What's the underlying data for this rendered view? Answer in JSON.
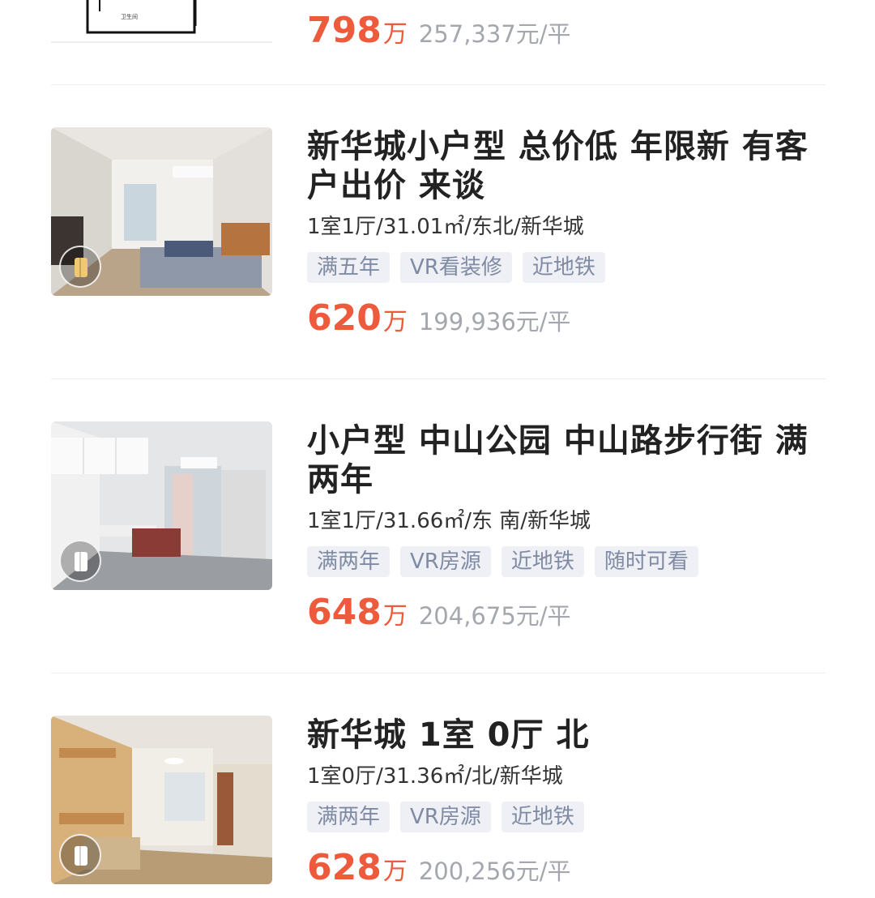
{
  "top_partial": {
    "floorplan_label": "卫生间",
    "price_total": "798",
    "price_unit": "万",
    "price_per": "257,337元/平"
  },
  "listings": [
    {
      "title": "新华城小户型 总价低 年限新 有客户出价 来谈",
      "desc": "1室1厅/31.01㎡/东北/新华城",
      "tags": [
        "满五年",
        "VR看装修",
        "近地铁"
      ],
      "price_total": "620",
      "price_unit": "万",
      "price_per": "199,936元/平",
      "image_icon": "vr-badge-icon"
    },
    {
      "title": "小户型 中山公园 中山路步行街 满两年",
      "desc": "1室1厅/31.66㎡/东 南/新华城",
      "tags": [
        "满两年",
        "VR房源",
        "近地铁",
        "随时可看"
      ],
      "price_total": "648",
      "price_unit": "万",
      "price_per": "204,675元/平",
      "image_icon": "vr-badge-icon"
    },
    {
      "title": "新华城 1室 0厅 北",
      "desc": "1室0厅/31.36㎡/北/新华城",
      "tags": [
        "满两年",
        "VR房源",
        "近地铁"
      ],
      "price_total": "628",
      "price_unit": "万",
      "price_per": "200,256元/平",
      "image_icon": "vr-badge-icon"
    }
  ],
  "colors": {
    "price": "#ee5a3c",
    "tag_bg": "#eef0f5",
    "tag_text": "#7f8aa3",
    "per_price": "#a4a7ad"
  }
}
